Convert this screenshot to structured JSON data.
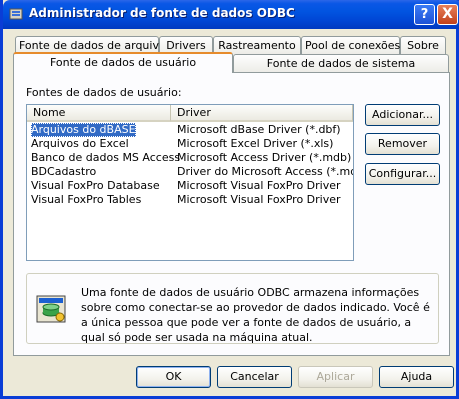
{
  "window": {
    "title": "Administrador de fonte de dados ODBC",
    "help_label": "?",
    "close_label": "X"
  },
  "tabs_back": [
    {
      "label": "Fonte de dados de arquivo"
    },
    {
      "label": "Drivers"
    },
    {
      "label": "Rastreamento"
    },
    {
      "label": "Pool de conexões"
    },
    {
      "label": "Sobre"
    }
  ],
  "tabs_front": [
    {
      "label": "Fonte de dados de usuário",
      "active": true
    },
    {
      "label": "Fonte de dados de sistema",
      "active": false
    }
  ],
  "panel": {
    "group_label": "Fontes de dados de usuário:",
    "columns": [
      "Nome",
      "Driver"
    ],
    "rows": [
      {
        "name": "Arquivos do dBASE",
        "driver": "Microsoft dBase Driver (*.dbf)",
        "selected": true
      },
      {
        "name": "Arquivos do Excel",
        "driver": "Microsoft Excel Driver (*.xls)"
      },
      {
        "name": "Banco de dados MS Access",
        "driver": "Microsoft Access Driver (*.mdb)"
      },
      {
        "name": "BDCadastro",
        "driver": "Driver do Microsoft Access (*.mdb)"
      },
      {
        "name": "Visual FoxPro Database",
        "driver": "Microsoft Visual FoxPro Driver"
      },
      {
        "name": "Visual FoxPro Tables",
        "driver": "Microsoft Visual FoxPro Driver"
      }
    ],
    "buttons": {
      "add": "Adicionar...",
      "remove": "Remover",
      "configure": "Configurar..."
    },
    "info_text": "Uma fonte de dados de usuário ODBC armazena informações sobre como conectar-se ao provedor de dados indicado. Você é a única pessoa que pode ver a fonte de dados de usuário, a qual só pode ser usada na máquina atual."
  },
  "footer": {
    "ok": "OK",
    "cancel": "Cancelar",
    "apply": "Aplicar",
    "help": "Ajuda"
  },
  "colors": {
    "titlebar": "#0054e3",
    "selection": "#316ac5",
    "tab_highlight": "#e68b2c",
    "face": "#ece9d8"
  }
}
